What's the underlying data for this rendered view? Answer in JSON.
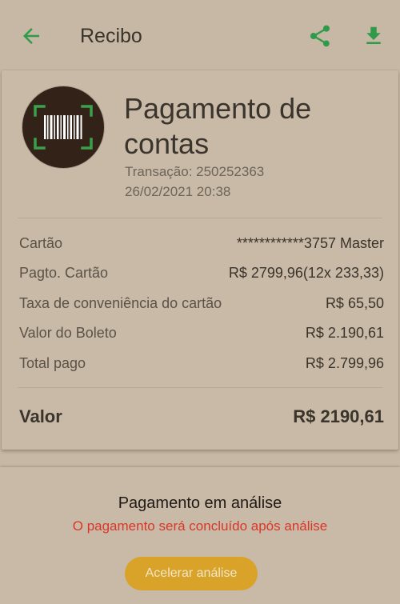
{
  "header": {
    "title": "Recibo",
    "back_icon": "arrow-left-icon",
    "share_icon": "share-icon",
    "download_icon": "download-icon",
    "accent_color": "#2e9a4a"
  },
  "receipt": {
    "badge_icon": "barcode-icon",
    "title": "Pagamento de contas",
    "transaction": "Transação: 250252363",
    "datetime": "26/02/2021 20:38",
    "details": [
      {
        "label": "Cartão",
        "value": "************3757 Master"
      },
      {
        "label": "Pagto. Cartão",
        "value": "R$ 2799,96(12x 233,33)"
      },
      {
        "label": "Taxa de conveniência do cartão",
        "value": "R$ 65,50"
      },
      {
        "label": "Valor do Boleto",
        "value": "R$ 2.190,61"
      },
      {
        "label": "Total pago",
        "value": "R$ 2.799,96"
      }
    ],
    "total_label": "Valor",
    "total_value": "R$ 2190,61"
  },
  "status": {
    "title": "Pagamento em análise",
    "message": "O pagamento será concluído após análise",
    "message_color": "#d9362a",
    "button_label": "Acelerar análise",
    "button_color": "#d9a229"
  }
}
